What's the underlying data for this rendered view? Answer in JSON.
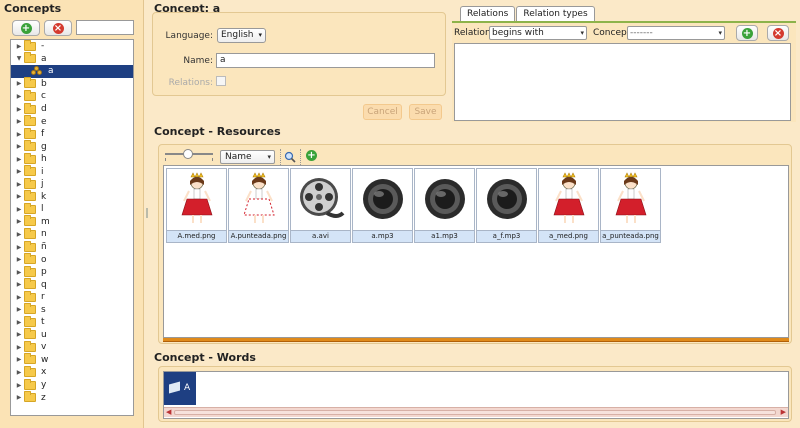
{
  "left": {
    "title": "Concepts",
    "add_label": "+",
    "remove_label": "×",
    "tree": [
      {
        "label": "-",
        "kind": "folder",
        "expanded": false
      },
      {
        "label": "a",
        "kind": "folder",
        "expanded": true
      },
      {
        "label": "a",
        "kind": "concept",
        "selected": true
      },
      {
        "label": "b",
        "kind": "folder",
        "expanded": false
      },
      {
        "label": "c",
        "kind": "folder",
        "expanded": false
      },
      {
        "label": "d",
        "kind": "folder",
        "expanded": false
      },
      {
        "label": "e",
        "kind": "folder",
        "expanded": false
      },
      {
        "label": "f",
        "kind": "folder",
        "expanded": false
      },
      {
        "label": "g",
        "kind": "folder",
        "expanded": false
      },
      {
        "label": "h",
        "kind": "folder",
        "expanded": false
      },
      {
        "label": "i",
        "kind": "folder",
        "expanded": false
      },
      {
        "label": "j",
        "kind": "folder",
        "expanded": false
      },
      {
        "label": "k",
        "kind": "folder",
        "expanded": false
      },
      {
        "label": "l",
        "kind": "folder",
        "expanded": false
      },
      {
        "label": "m",
        "kind": "folder",
        "expanded": false
      },
      {
        "label": "n",
        "kind": "folder",
        "expanded": false
      },
      {
        "label": "ñ",
        "kind": "folder",
        "expanded": false
      },
      {
        "label": "o",
        "kind": "folder",
        "expanded": false
      },
      {
        "label": "p",
        "kind": "folder",
        "expanded": false
      },
      {
        "label": "q",
        "kind": "folder",
        "expanded": false
      },
      {
        "label": "r",
        "kind": "folder",
        "expanded": false
      },
      {
        "label": "s",
        "kind": "folder",
        "expanded": false
      },
      {
        "label": "t",
        "kind": "folder",
        "expanded": false
      },
      {
        "label": "u",
        "kind": "folder",
        "expanded": false
      },
      {
        "label": "v",
        "kind": "folder",
        "expanded": false
      },
      {
        "label": "w",
        "kind": "folder",
        "expanded": false
      },
      {
        "label": "x",
        "kind": "folder",
        "expanded": false
      },
      {
        "label": "y",
        "kind": "folder",
        "expanded": false
      },
      {
        "label": "z",
        "kind": "folder",
        "expanded": false
      }
    ]
  },
  "concept": {
    "title": "Concept: a",
    "language_label": "Language:",
    "language_value": "English",
    "name_label": "Name:",
    "name_value": "a",
    "relations_label": "Relations:",
    "cancel_label": "Cancel",
    "save_label": "Save"
  },
  "relations": {
    "tabs": [
      "Relations",
      "Relation types"
    ],
    "relation_label": "Relation:",
    "relation_value": "begins with",
    "concept_label": "Concept:",
    "concept_value": "-------",
    "add_label": "+",
    "remove_label": "×"
  },
  "resources": {
    "title": "Concept - Resources",
    "sort_value": "Name",
    "items": [
      {
        "label": "A.med.png",
        "icon": "princess-image"
      },
      {
        "label": "A.punteada.png",
        "icon": "princess-dotted-image"
      },
      {
        "label": "a.avi",
        "icon": "film-reel-icon"
      },
      {
        "label": "a.mp3",
        "icon": "speaker-icon"
      },
      {
        "label": "a1.mp3",
        "icon": "speaker-icon"
      },
      {
        "label": "a_f.mp3",
        "icon": "speaker-icon"
      },
      {
        "label": "a_med.png",
        "icon": "princess-image"
      },
      {
        "label": "a_punteada.png",
        "icon": "princess-image"
      }
    ]
  },
  "words": {
    "title": "Concept - Words",
    "items": [
      {
        "label": "A"
      }
    ]
  },
  "colors": {
    "background": "#fbe9c8",
    "selection": "#1e3f82",
    "accent_green": "#3aa23a",
    "accent_red": "#d43a2f",
    "progress_orange": "#e08a1a"
  }
}
